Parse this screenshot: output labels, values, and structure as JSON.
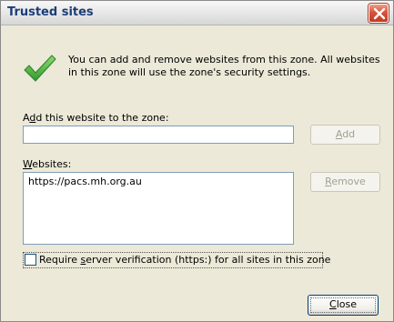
{
  "window": {
    "title": "Trusted sites"
  },
  "info": {
    "message": "You can add and remove websites from this zone. All websites in this zone will use the zone's security settings."
  },
  "add_section": {
    "label_prefix": "A",
    "label_access": "d",
    "label_rest": "d this website to the zone:",
    "input_value": "",
    "add_button_access": "A",
    "add_button_rest": "dd"
  },
  "websites": {
    "label_access": "W",
    "label_rest": "ebsites:",
    "items": [
      "https://pacs.mh.org.au"
    ],
    "remove_button_access": "R",
    "remove_button_rest": "emove"
  },
  "verification": {
    "checked": false,
    "label_before": "Require ",
    "label_access": "s",
    "label_after": "erver verification (https:) for all sites in this zone"
  },
  "footer": {
    "close_access": "C",
    "close_rest": "lose"
  },
  "colors": {
    "title_text": "#1c3d78",
    "close_button": "#d8533a",
    "checkmark": "#3aa53a",
    "dialog_background": "#ece9d8"
  },
  "icons": {
    "info": "green-checkmark-icon",
    "close": "close-x-icon"
  }
}
